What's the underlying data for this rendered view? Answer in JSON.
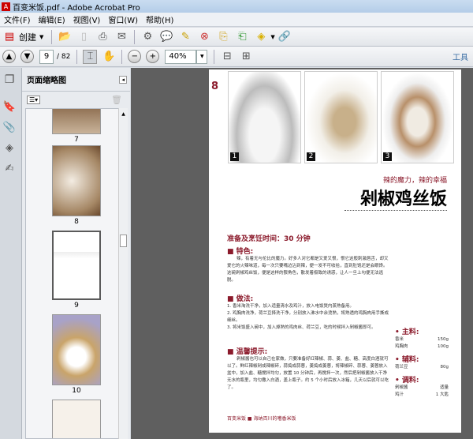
{
  "window": {
    "title": "百变米饭.pdf - Adobe Acrobat Pro"
  },
  "menu": [
    "文件(F)",
    "编辑(E)",
    "视图(V)",
    "窗口(W)",
    "帮助(H)"
  ],
  "toolbar": {
    "create_label": "创建",
    "page_current": "9",
    "page_total": "/ 82",
    "zoom": "40%",
    "tools_label": "工具"
  },
  "nav_panel": {
    "title": "页面缩略图",
    "thumbnails": [
      "7",
      "8",
      "9",
      "10"
    ]
  },
  "page": {
    "page_number": "8",
    "photo_labels": [
      "1",
      "2",
      "3"
    ],
    "subtitle": "辣的魔力，辣的幸福",
    "title": "剁椒鸡丝饭",
    "time": "准备及烹饪时间：30 分钟",
    "feature_heading": "特色:",
    "feature_text": "辣，有着无与伦比的魔力。好多人对它都是又爱又恨，恨它这般刺激唇舌，却又爱它的火辣味道，每一次只要嘴边沾到辣，便一发不可收拾，直到肚饱还是会眼馋。这碗剁椒鸡丝饭，便是这样的狠角色，散发着极致的诱惑，让人一旦上勾便无法逃脱。",
    "method_heading": "做法:",
    "steps": [
      "1. 香米淘洗干净，加入适量清水及鸡汁，放入电饭煲内蒸熟备用。",
      "2. 鸡胸肉洗净，荷兰豆择洗干净，分别放入沸水中余烫熟，将熟透的鸡胸肉用手撕成细丝。",
      "3. 将米饭盛入碗中，加入焯熟的鸡肉丝、荷兰豆，吃的时候拌入剁椒酱即可。"
    ],
    "tips_heading": "温馨提示:",
    "tips_text": "剁椒酱也可以自己在家做，只要准备好红辣椒、蒜、姜、盐、糖、高度白酒就可以了。鲜红辣椒剁成辣椒碎，蒜捣成蒜蓉，姜捣成姜蓉，将辣椒碎、蒜蓉、姜蓉放入盆中，加入盐、糖搅拌均匀，放置 10 分钟后，再搅拌一次，然后把剁椒酱放入干净无水的瓶里，均匀撒入白酒，盖上瓶子。约 5 个小时后放入冰箱，几天以后就可以吃了。",
    "ingredients": [
      {
        "heading": "主料:",
        "items": [
          [
            "香米",
            "150g"
          ],
          [
            "鸡胸肉",
            "100g"
          ]
        ]
      },
      {
        "heading": "辅料:",
        "items": [
          [
            "荷兰豆",
            "80g"
          ]
        ]
      },
      {
        "heading": "调料:",
        "items": [
          [
            "剁椒酱",
            "适量"
          ],
          [
            "鸡汁",
            "1 大匙"
          ]
        ]
      }
    ],
    "footer_left": "百变米饭",
    "footer_right": "海纳百川的嗜香米饭"
  }
}
